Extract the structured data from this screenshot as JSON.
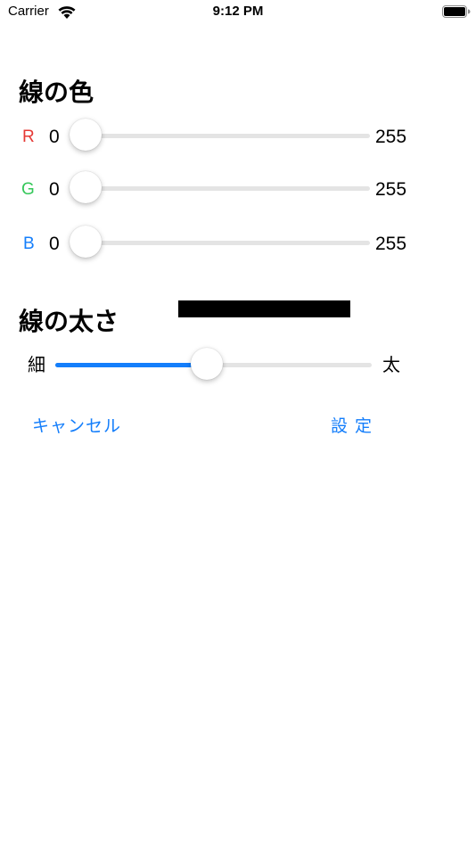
{
  "status_bar": {
    "carrier": "Carrier",
    "time": "9:12 PM"
  },
  "color_section": {
    "title": "線の色",
    "channels": [
      {
        "label": "R",
        "min": "0",
        "max": "255",
        "value": 0,
        "color": "#e53935"
      },
      {
        "label": "G",
        "min": "0",
        "max": "255",
        "value": 0,
        "color": "#34c759"
      },
      {
        "label": "B",
        "min": "0",
        "max": "255",
        "value": 0,
        "color": "#147efb"
      }
    ]
  },
  "preview": {
    "color": "#000000"
  },
  "width_section": {
    "title": "線の太さ",
    "min_label": "細",
    "max_label": "太",
    "value_fraction": 0.48
  },
  "actions": {
    "cancel_label": "キャンセル",
    "set_label": "設 定"
  },
  "colors": {
    "accent": "#147efb",
    "track": "#e4e4e4"
  }
}
